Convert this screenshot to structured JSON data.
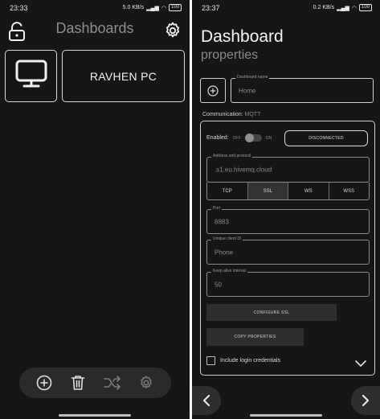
{
  "left": {
    "status": {
      "time": "23:33",
      "net": "5.0 KB/s",
      "battery": "100"
    },
    "title": "Dashboards",
    "icons": {
      "lock": "lock-open-icon",
      "settings": "gear-icon",
      "tile": "monitor-icon"
    },
    "dashboards": [
      {
        "name": "RAVHEN PC"
      }
    ],
    "bottom_bar": [
      "add-circle-icon",
      "trash-icon",
      "shuffle-icon",
      "gear-icon"
    ]
  },
  "right": {
    "status": {
      "time": "23:37",
      "net": "0.2 KB/s",
      "battery": "100"
    },
    "title": "Dashboard",
    "subtitle": "properties",
    "dashboard_name": {
      "label": "Dashboard name",
      "value": "Home"
    },
    "communication": {
      "label": "Communication:",
      "value": "MQTT"
    },
    "enabled": {
      "label": "Enabled:",
      "off": "OFF",
      "on": "ON",
      "state": false
    },
    "connection_button": "DISCONNECTED",
    "address": {
      "label": "Address and protocol",
      "value": ".s1.eu.hivemq.cloud"
    },
    "protocols": [
      "TCP",
      "SSL",
      "WS",
      "WSS"
    ],
    "protocol_selected": "SSL",
    "port": {
      "label": "Port",
      "value": "8883"
    },
    "client_id": {
      "label": "Unique client ID",
      "value": "Phone"
    },
    "keep_alive": {
      "label": "Keep alive interval",
      "value": "50"
    },
    "configure_ssl_button": "CONFIGURE SSL",
    "copy_properties_button": "COPY PROPERTIES",
    "include_credentials": {
      "label": "Include login credentials",
      "checked": false
    },
    "colors": {
      "background": "#161616",
      "outline": "#cfcfcf",
      "muted": "#8a8a8a",
      "button": "#2e2e2e"
    }
  }
}
